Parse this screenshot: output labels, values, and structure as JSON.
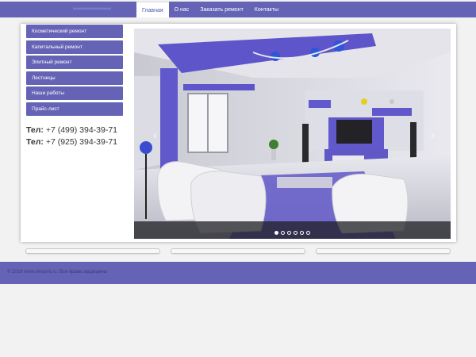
{
  "nav": {
    "items": [
      {
        "label": "Главная",
        "active": true
      },
      {
        "label": "О нас",
        "active": false
      },
      {
        "label": "Заказать ремонт",
        "active": false
      },
      {
        "label": "Контакты",
        "active": false
      }
    ]
  },
  "sidebar": {
    "items": [
      {
        "label": "Косметический ремонт"
      },
      {
        "label": "Капитальный ремонт"
      },
      {
        "label": "Элитный ремонт"
      },
      {
        "label": "Лестницы"
      },
      {
        "label": "Наши работы"
      },
      {
        "label": "Прайс-лист"
      }
    ]
  },
  "contacts": {
    "phones": [
      {
        "prefix": "Тел:",
        "number": "+7 (499) 394-39-71"
      },
      {
        "prefix": "Тел:",
        "number": "+7 (925) 394-39-71"
      }
    ]
  },
  "slider": {
    "slide_count": 6,
    "active_slide": 1,
    "prev_icon": "chevron-left-icon",
    "next_icon": "chevron-right-icon"
  },
  "footer": {
    "copyright": "© 2016 www.vivasmi.ru. Все права защищены"
  },
  "colors": {
    "brand": "#6563b5",
    "active_nav_text": "#4a5ab0"
  }
}
